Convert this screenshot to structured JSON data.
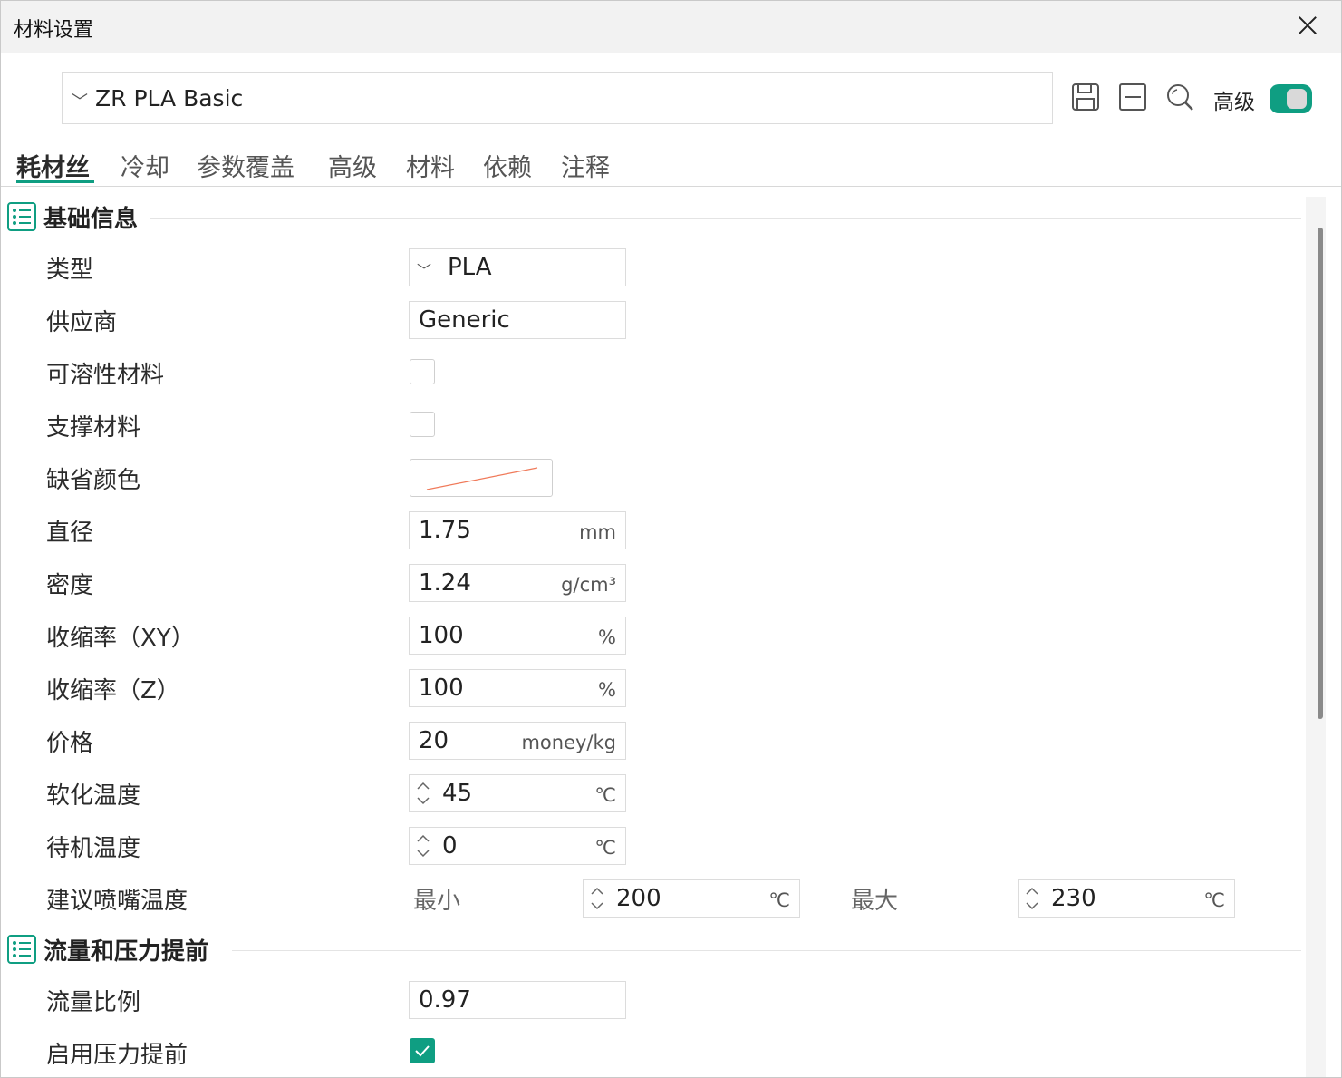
{
  "window": {
    "title": "材料设置"
  },
  "preset": {
    "name": "ZR PLA Basic"
  },
  "toolbar": {
    "advanced_label": "高级",
    "advanced_enabled": true
  },
  "tabs": [
    "耗材丝",
    "冷却",
    "参数覆盖",
    "高级",
    "材料",
    "依赖",
    "注释"
  ],
  "sections": {
    "basic": {
      "title": "基础信息"
    },
    "flow": {
      "title": "流量和压力提前"
    }
  },
  "fields": {
    "type": {
      "label": "类型",
      "value": "PLA"
    },
    "vendor": {
      "label": "供应商",
      "value": "Generic"
    },
    "soluble": {
      "label": "可溶性材料",
      "checked": false
    },
    "support": {
      "label": "支撑材料",
      "checked": false
    },
    "default_color": {
      "label": "缺省颜色",
      "value": ""
    },
    "diameter": {
      "label": "直径",
      "value": "1.75",
      "unit": "mm"
    },
    "density": {
      "label": "密度",
      "value": "1.24",
      "unit": "g/cm³"
    },
    "shrink_xy": {
      "label": "收缩率（XY）",
      "value": "100",
      "unit": "%"
    },
    "shrink_z": {
      "label": "收缩率（Z）",
      "value": "100",
      "unit": "%"
    },
    "price": {
      "label": "价格",
      "value": "20",
      "unit": "money/kg"
    },
    "softening_temp": {
      "label": "软化温度",
      "value": "45",
      "unit": "℃"
    },
    "standby_temp": {
      "label": "待机温度",
      "value": "0",
      "unit": "℃"
    },
    "nozzle_temp": {
      "label": "建议喷嘴温度",
      "min_label": "最小",
      "min_value": "200",
      "max_label": "最大",
      "max_value": "230",
      "unit": "℃"
    },
    "flow_ratio": {
      "label": "流量比例",
      "value": "0.97"
    },
    "pressure_advance": {
      "label": "启用压力提前",
      "checked": true
    }
  },
  "colors": {
    "accent": "#0f9e82"
  }
}
